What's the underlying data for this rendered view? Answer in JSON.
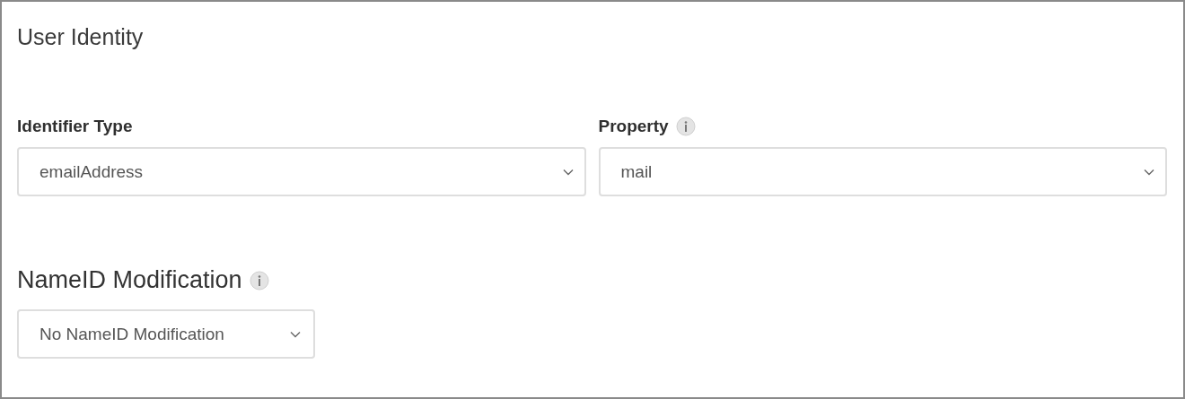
{
  "section": {
    "title": "User Identity"
  },
  "fields": [
    {
      "label": "Identifier Type",
      "info": false,
      "value": "emailAddress"
    },
    {
      "label": "Property",
      "info": true,
      "value": "mail"
    }
  ],
  "nameid": {
    "title": "NameID Modification",
    "info": true,
    "value": "No NameID Modification"
  }
}
